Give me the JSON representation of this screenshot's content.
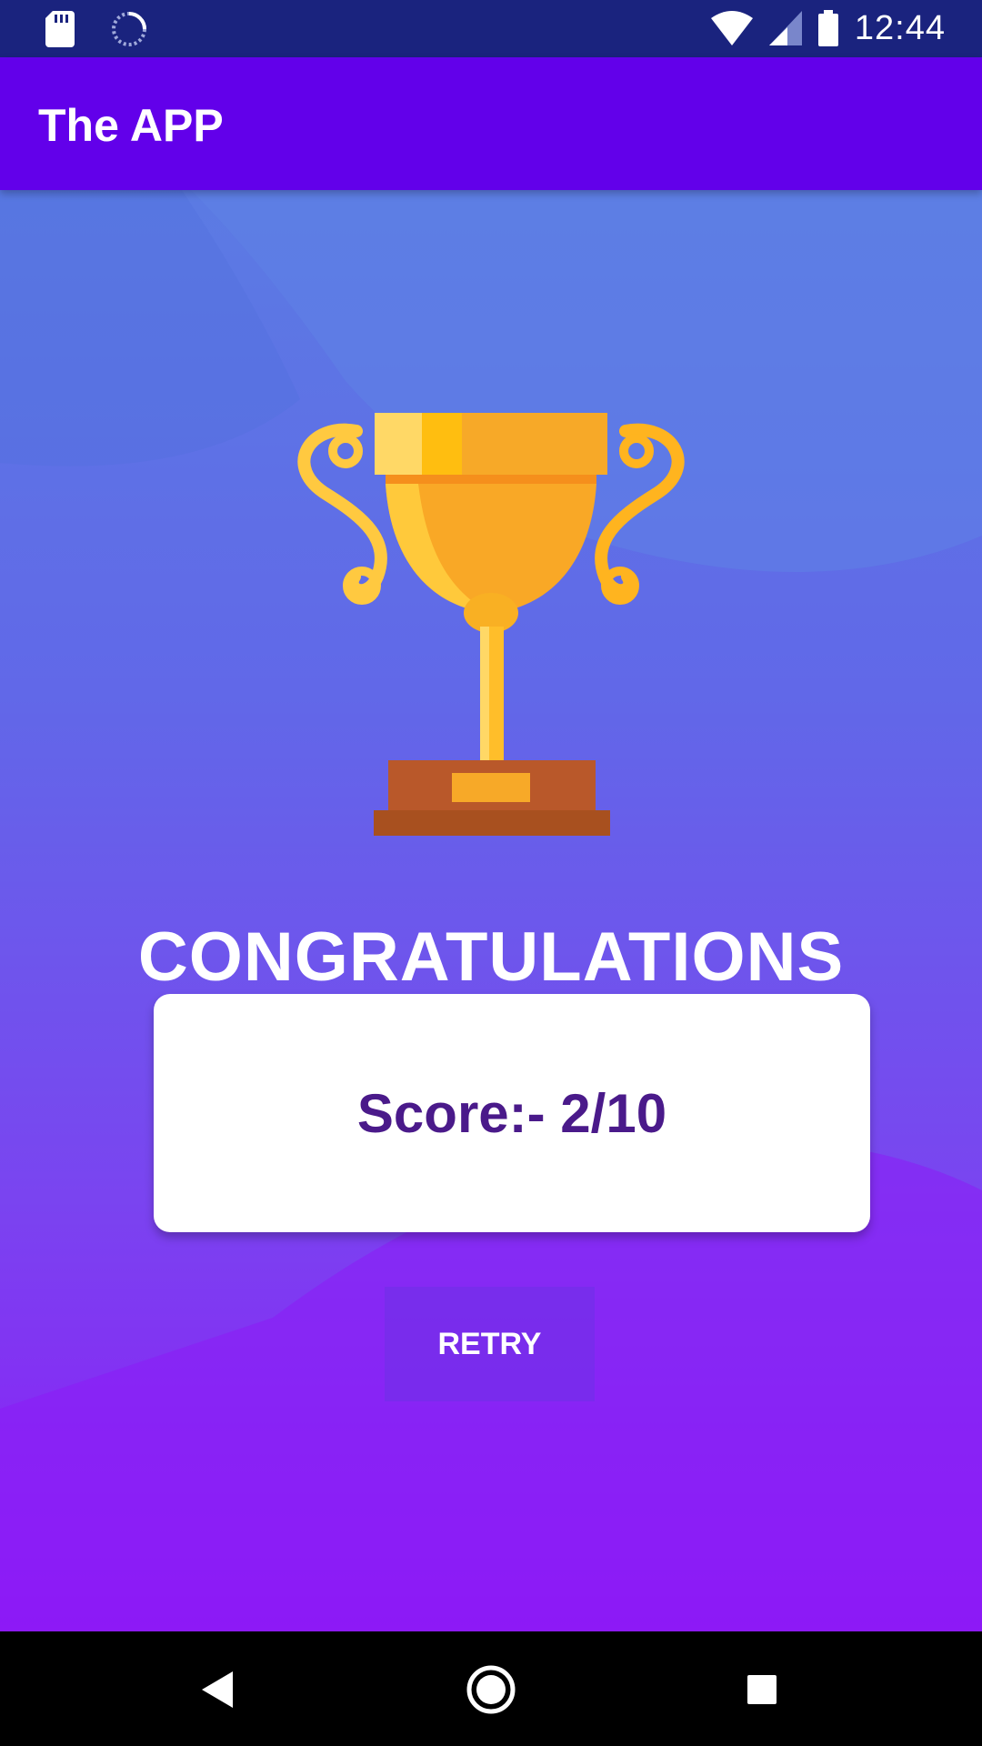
{
  "status_bar": {
    "time": "12:44",
    "icons": [
      "sd-card-icon",
      "loading-icon",
      "wifi-icon",
      "signal-icon",
      "battery-icon"
    ]
  },
  "app_bar": {
    "title": "The APP"
  },
  "result": {
    "heading": "CONGRATULATIONS",
    "score_text": "Score:- 2/10",
    "retry_label": "RETRY"
  },
  "nav_bar": {
    "icons": [
      "back-icon",
      "home-icon",
      "recents-icon"
    ]
  },
  "colors": {
    "status_bar": "#1a237e",
    "app_bar": "#6200ea",
    "score_text": "#4a1a8a",
    "background_top": "#5b7be3",
    "background_bottom": "#8e17f7"
  }
}
